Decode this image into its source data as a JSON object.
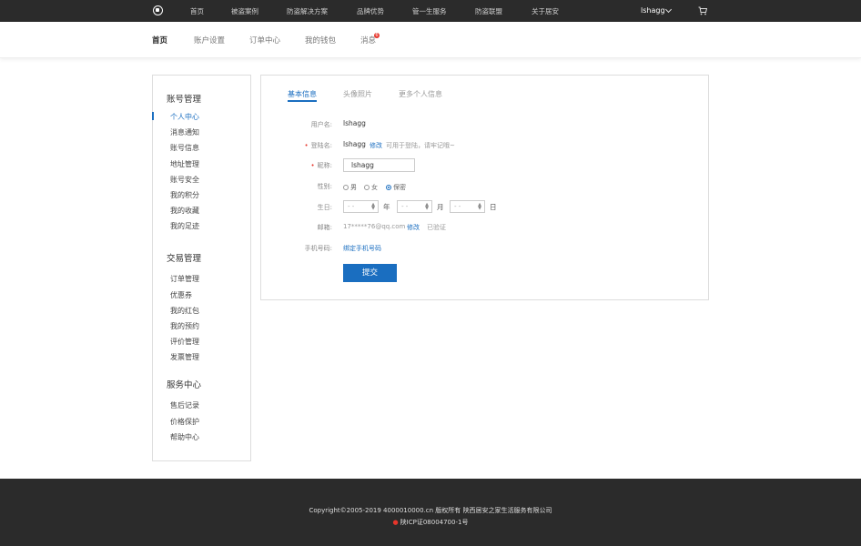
{
  "topnav": {
    "items": [
      "首页",
      "被盗案例",
      "防盗解决方案",
      "品牌优势",
      "管一生服务",
      "防盗联盟",
      "关于居安"
    ],
    "user": "lshagg"
  },
  "subnav": {
    "items": [
      "首页",
      "账户设置",
      "订单中心",
      "我的钱包",
      "消息"
    ],
    "message_badge": "6"
  },
  "sidebar": {
    "groups": [
      {
        "title": "账号管理",
        "items": [
          "个人中心",
          "消息通知",
          "账号信息",
          "地址管理",
          "账号安全",
          "我的积分",
          "我的收藏",
          "我的足迹"
        ]
      },
      {
        "title": "交易管理",
        "items": [
          "订单管理",
          "优惠券",
          "我的红包",
          "我的预约",
          "评价管理",
          "发票管理"
        ]
      },
      {
        "title": "服务中心",
        "items": [
          "售后记录",
          "价格保护",
          "帮助中心"
        ]
      }
    ],
    "active_item": "个人中心"
  },
  "tabs": [
    "基本信息",
    "头像照片",
    "更多个人信息"
  ],
  "form": {
    "username_label": "用户名:",
    "username_value": "lshagg",
    "login_label": "登陆名:",
    "login_value": "lshagg",
    "login_edit": "修改",
    "login_hint": "可用于登陆，请牢记哦~",
    "nickname_label": "昵称:",
    "nickname_value": "lshagg",
    "gender_label": "性别:",
    "gender_options": [
      "男",
      "女",
      "保密"
    ],
    "gender_selected": "保密",
    "birthday_label": "生日:",
    "birthday_placeholder": "- -",
    "birthday_units": [
      "年",
      "月",
      "日"
    ],
    "email_label": "邮箱:",
    "email_value": "17*****76@qq.com",
    "email_edit": "修改",
    "email_status": "已验证",
    "phone_label": "手机号码:",
    "phone_bind": "绑定手机号码",
    "submit_label": "提交"
  },
  "footer": {
    "copyright": "Copyright©2005-2019 4000010000.cn 版权所有 陕西居安之家生活服务有限公司",
    "icp": "陕ICP证08004700-1号"
  },
  "colors": {
    "accent": "#1a6ec0",
    "topbar": "#2b2b2b",
    "required": "#e6352b"
  }
}
